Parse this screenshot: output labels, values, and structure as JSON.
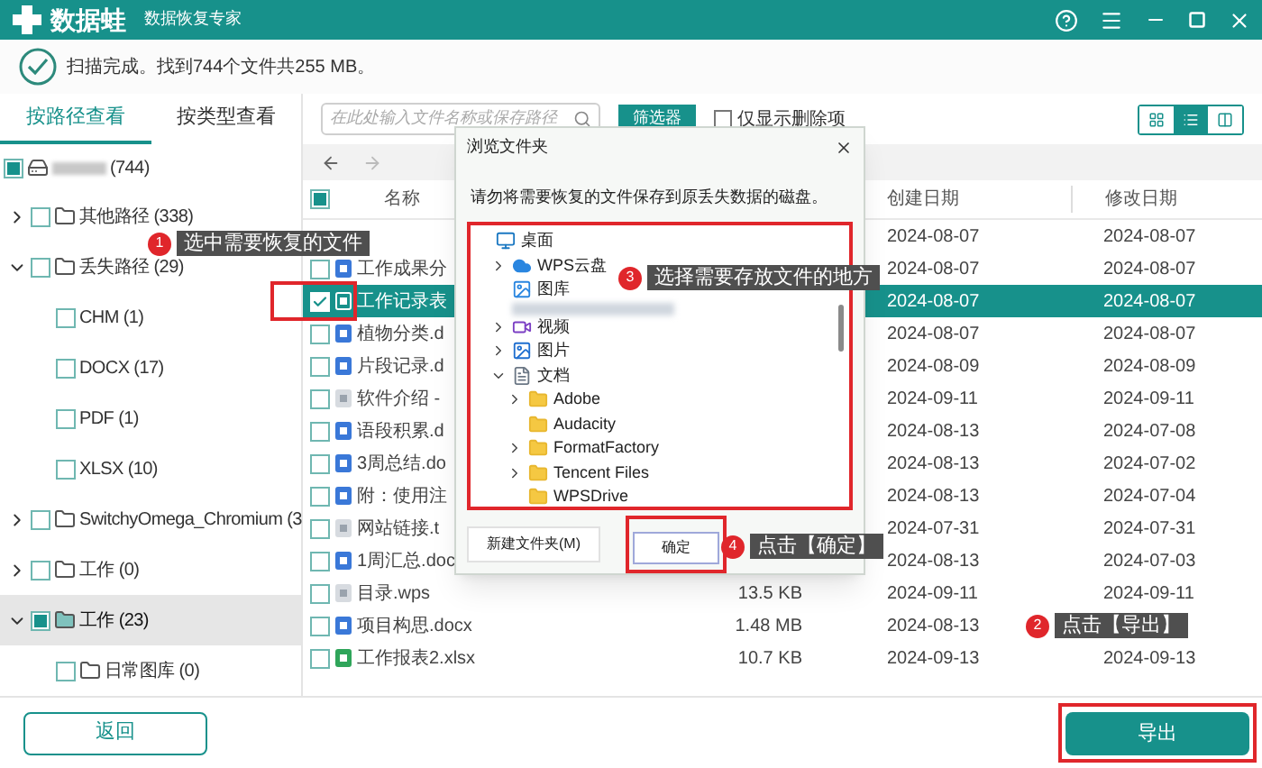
{
  "app": {
    "name": "数据蛙",
    "subtitle": "数据恢复专家"
  },
  "status": {
    "text": "扫描完成。找到744个文件共255 MB。"
  },
  "view_tabs": [
    {
      "label": "按路径查看",
      "selected": true
    },
    {
      "label": "按类型查看",
      "selected": false
    }
  ],
  "tree": [
    {
      "kind": "drive",
      "label": "(744)",
      "checked": false,
      "mixed": true,
      "selected": false,
      "children": [
        {
          "kind": "folder",
          "label": "其他路径 (338)",
          "checked": false,
          "mixed": false,
          "expanded": false,
          "selected": false
        },
        {
          "kind": "folder",
          "label": "丢失路径 (29)",
          "checked": false,
          "mixed": false,
          "expanded": true,
          "selected": false,
          "children": [
            {
              "kind": "filetype",
              "label": "CHM (1)",
              "checked": false,
              "mixed": false,
              "selected": false
            },
            {
              "kind": "filetype",
              "label": "DOCX (17)",
              "checked": false,
              "mixed": false,
              "selected": false
            },
            {
              "kind": "filetype",
              "label": "PDF (1)",
              "checked": false,
              "mixed": false,
              "selected": false
            },
            {
              "kind": "filetype",
              "label": "XLSX (10)",
              "checked": false,
              "mixed": false,
              "selected": false
            }
          ]
        },
        {
          "kind": "folder",
          "label": "SwitchyOmega_Chromium (3",
          "checked": false,
          "mixed": false,
          "expanded": false,
          "selected": false
        },
        {
          "kind": "folder",
          "label": "工作 (0)",
          "checked": false,
          "mixed": false,
          "expanded": false,
          "selected": false
        },
        {
          "kind": "folder",
          "label": "工作 (23)",
          "checked": false,
          "mixed": true,
          "expanded": true,
          "selected": true,
          "children": [
            {
              "kind": "folder",
              "label": "日常图库 (0)",
              "checked": false,
              "mixed": false,
              "selected": false
            }
          ]
        }
      ]
    }
  ],
  "toolbar": {
    "search": {
      "placeholder": "在此处输入文件名称或保存路径"
    },
    "filter_button": "筛选器",
    "deleted_only": {
      "label": "仅显示删除项",
      "checked": false
    },
    "view_modes": [
      {
        "kind": "grid",
        "selected": false
      },
      {
        "kind": "list",
        "selected": true
      },
      {
        "kind": "columns",
        "selected": false
      }
    ]
  },
  "table": {
    "header_checked": false,
    "header_mixed": true,
    "columns": [
      "名称",
      "创建日期",
      "修改日期"
    ],
    "rows": [
      {
        "created": "2024-08-07",
        "modified": "2024-08-07",
        "selected": false
      },
      {
        "name": "工作成果分",
        "kind": "doc",
        "checked": false,
        "created": "2024-08-07",
        "modified": "2024-08-07",
        "selected": false
      },
      {
        "name": "工作记录表",
        "kind": "sheet",
        "checked": true,
        "created": "2024-08-07",
        "modified": "2024-08-07",
        "selected": true
      },
      {
        "name": "植物分类.d",
        "kind": "doc",
        "checked": false,
        "created": "2024-08-07",
        "modified": "2024-08-07",
        "selected": false
      },
      {
        "name": "片段记录.d",
        "kind": "doc",
        "checked": false,
        "created": "2024-08-09",
        "modified": "2024-08-09",
        "selected": false
      },
      {
        "name": "软件介绍 -",
        "kind": "plain",
        "checked": false,
        "created": "2024-09-11",
        "modified": "2024-09-11",
        "selected": false
      },
      {
        "name": "语段积累.d",
        "kind": "doc",
        "checked": false,
        "created": "2024-08-13",
        "modified": "2024-07-08",
        "selected": false
      },
      {
        "name": "3周总结.do",
        "kind": "doc",
        "checked": false,
        "created": "2024-08-13",
        "modified": "2024-07-02",
        "selected": false
      },
      {
        "name": "附：使用注",
        "kind": "doc",
        "checked": false,
        "created": "2024-08-13",
        "modified": "2024-07-04",
        "selected": false
      },
      {
        "name": "网站链接.t",
        "kind": "plain",
        "checked": false,
        "created": "2024-07-31",
        "modified": "2024-07-31",
        "selected": false
      },
      {
        "name": "1周汇总.doc",
        "kind": "doc",
        "checked": false,
        "created": "2024-08-13",
        "modified": "2024-07-03",
        "selected": false
      },
      {
        "name": "目录.wps",
        "kind": "plain",
        "checked": false,
        "size": "13.5 KB",
        "created": "2024-09-11",
        "modified": "2024-09-11",
        "selected": false
      },
      {
        "name": "项目构思.docx",
        "kind": "doc",
        "checked": false,
        "size": "1.48 MB",
        "created": "2024-08-13",
        "selected": false
      },
      {
        "name": "工作报表2.xlsx",
        "kind": "sheet",
        "checked": false,
        "size": "10.7 KB",
        "created": "2024-09-13",
        "modified": "2024-09-13",
        "selected": false
      }
    ]
  },
  "dialog": {
    "title": "浏览文件夹",
    "message": "请勿将需要恢复的文件保存到原丢失数据的磁盘。",
    "tree": [
      {
        "kind": "desktop",
        "label": "桌面",
        "children": [
          {
            "kind": "cloud",
            "label": "WPS云盘",
            "expanded": false
          },
          {
            "kind": "gallery",
            "label": "图库"
          },
          {
            "kind": "blurred"
          },
          {
            "kind": "video",
            "label": "视频",
            "expanded": false
          },
          {
            "kind": "picture",
            "label": "图片",
            "expanded": false
          },
          {
            "kind": "documents",
            "label": "文档",
            "expanded": true,
            "children": [
              {
                "kind": "folder",
                "label": "Adobe",
                "expanded": false
              },
              {
                "kind": "folder",
                "label": "Audacity"
              },
              {
                "kind": "folder",
                "label": "FormatFactory",
                "expanded": false
              },
              {
                "kind": "folder",
                "label": "Tencent Files",
                "expanded": false
              },
              {
                "kind": "folder",
                "label": "WPSDrive"
              }
            ]
          }
        ]
      }
    ],
    "buttons": [
      "新建文件夹(M)",
      "确定"
    ]
  },
  "callouts": [
    {
      "number": "1",
      "text": "选中需要恢复的文件"
    },
    {
      "number": "3",
      "text": "选择需要存放文件的地方"
    },
    {
      "number": "4",
      "text": "点击【确定】"
    },
    {
      "number": "2",
      "text": "点击【导出】"
    }
  ],
  "bottom": {
    "back_button": "返回",
    "export_button": "导出"
  }
}
